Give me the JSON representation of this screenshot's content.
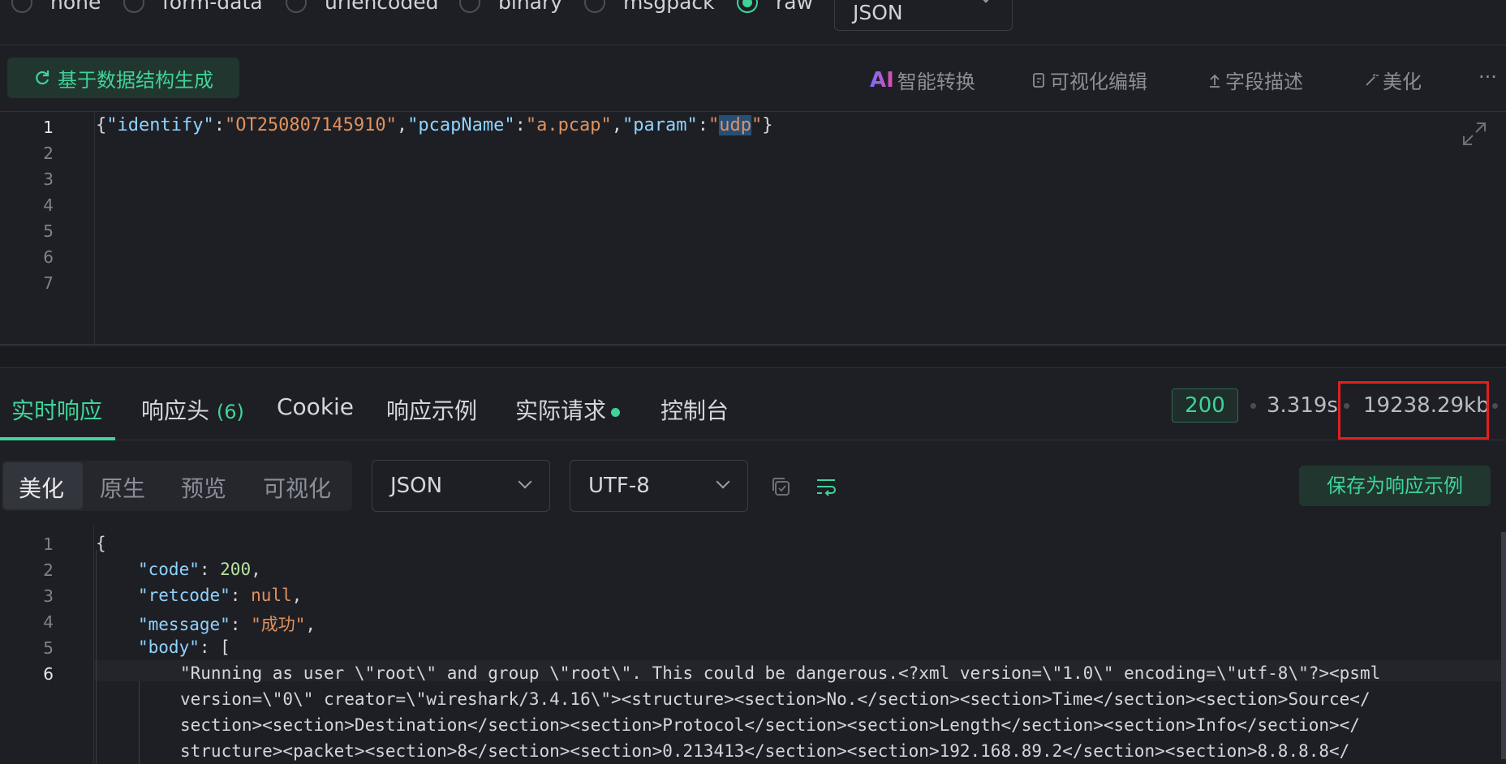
{
  "body_type": {
    "options": [
      "none",
      "form-data",
      "urlencoded",
      "binary",
      "msgpack",
      "raw"
    ],
    "selected": "raw",
    "format": "JSON"
  },
  "toolbar": {
    "generate_label": "基于数据结构生成",
    "ai_mark": "AI",
    "ai_convert": "智能转换",
    "visual_edit": "可视化编辑",
    "field_desc": "字段描述",
    "beautify": "美化",
    "more": "···"
  },
  "request": {
    "line_numbers": [
      "1",
      "2",
      "3",
      "4",
      "5",
      "6",
      "7"
    ],
    "tokens": {
      "b1": "{",
      "k1": "\"identify\"",
      "c1": ":",
      "v1": "\"OT250807145910\"",
      "m1": ",",
      "k2": "\"pcapName\"",
      "c2": ":",
      "v2": "\"a.pcap\"",
      "m2": ",",
      "k3": "\"param\"",
      "c3": ":",
      "q1": "\"",
      "sel": "udp",
      "q2": "\"",
      "b2": "}"
    }
  },
  "response_tabs": {
    "realtime": "实时响应",
    "headers": "响应头",
    "headers_count": "(6)",
    "cookie": "Cookie",
    "example": "响应示例",
    "actual": "实际请求",
    "console": "控制台"
  },
  "status": {
    "code": "200",
    "time": "3.319s",
    "size": "19238.29kb",
    "colors": {
      "ok": "#3ed49a",
      "highlight_box": "#e02020"
    }
  },
  "response_toolbar": {
    "views": [
      "美化",
      "原生",
      "预览",
      "可视化"
    ],
    "active_view": "美化",
    "format": "JSON",
    "encoding": "UTF-8",
    "save_example": "保存为响应示例"
  },
  "response": {
    "line_numbers": [
      "1",
      "2",
      "3",
      "4",
      "5",
      "6"
    ],
    "l1": "{",
    "l2": {
      "key": "\"code\"",
      "sep": ": ",
      "val": "200",
      "end": ","
    },
    "l3": {
      "key": "\"retcode\"",
      "sep": ": ",
      "val": "null",
      "end": ","
    },
    "l4": {
      "key": "\"message\"",
      "sep": ": ",
      "val": "\"成功\"",
      "end": ","
    },
    "l5": {
      "key": "\"body\"",
      "sep": ": ",
      "val": "["
    },
    "l6": [
      "\"Running as user \\\"root\\\" and group \\\"root\\\". This could be dangerous.<?xml version=\\\"1.0\\\" encoding=\\\"utf-8\\\"?><psml",
      "version=\\\"0\\\" creator=\\\"wireshark/3.4.16\\\"><structure><section>No.</section><section>Time</section><section>Source</",
      "section><section>Destination</section><section>Protocol</section><section>Length</section><section>Info</section></",
      "structure><packet><section>8</section><section>0.213413</section><section>192.168.89.2</section><section>8.8.8.8</"
    ]
  }
}
